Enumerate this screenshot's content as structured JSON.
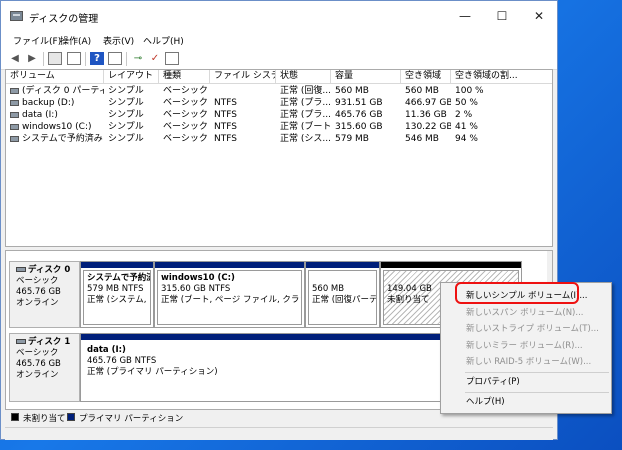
{
  "window": {
    "title": "ディスクの管理",
    "min": "—",
    "max": "☐",
    "close": "✕"
  },
  "menu": [
    "ファイル(F)",
    "操作(A)",
    "表示(V)",
    "ヘルプ(H)"
  ],
  "volumes": {
    "columns": [
      "ボリューム",
      "レイアウト",
      "種類",
      "ファイル システム",
      "状態",
      "容量",
      "空き領域",
      "空き領域の割..."
    ],
    "rows": [
      [
        "(ディスク 0 パーティ...",
        "シンプル",
        "ベーシック",
        "",
        "正常 (回復...",
        "560 MB",
        "560 MB",
        "100 %"
      ],
      [
        "backup (D:)",
        "シンプル",
        "ベーシック",
        "NTFS",
        "正常 (プラ...",
        "931.51 GB",
        "466.97 GB",
        "50 %"
      ],
      [
        "data (I:)",
        "シンプル",
        "ベーシック",
        "NTFS",
        "正常 (プラ...",
        "465.76 GB",
        "11.36 GB",
        "2 %"
      ],
      [
        "windows10 (C:)",
        "シンプル",
        "ベーシック",
        "NTFS",
        "正常 (ブート...",
        "315.60 GB",
        "130.22 GB",
        "41 %"
      ],
      [
        "システムで予約済み",
        "シンプル",
        "ベーシック",
        "NTFS",
        "正常 (シス...",
        "579 MB",
        "546 MB",
        "94 %"
      ]
    ]
  },
  "disks": [
    {
      "name": "ディスク 0",
      "type": "ベーシック",
      "size": "465.76 GB",
      "status": "オンライン",
      "partitions": [
        {
          "name": "システムで予約済",
          "size": "579 MB NTFS",
          "status": "正常 (システム, ア"
        },
        {
          "name": "windows10  (C:)",
          "size": "315.60 GB NTFS",
          "status": "正常 (ブート, ページ ファイル, クラッシュ ダ"
        },
        {
          "name": "",
          "size": "560 MB",
          "status": "正常 (回復パーテ"
        },
        {
          "name": "",
          "size": "149.04 GB",
          "status": "未割り当て"
        }
      ]
    },
    {
      "name": "ディスク 1",
      "type": "ベーシック",
      "size": "465.76 GB",
      "status": "オンライン",
      "partitions": [
        {
          "name": "data  (I:)",
          "size": "465.76 GB NTFS",
          "status": "正常 (プライマリ パーティション)"
        }
      ]
    }
  ],
  "legend": {
    "unallocated": "未割り当て",
    "primary": "プライマリ パーティション"
  },
  "context_menu": {
    "items": [
      {
        "label": "新しいシンプル ボリューム(I)...",
        "enabled": true
      },
      {
        "label": "新しいスパン ボリューム(N)...",
        "enabled": false
      },
      {
        "label": "新しいストライプ ボリューム(T)...",
        "enabled": false
      },
      {
        "label": "新しいミラー ボリューム(R)...",
        "enabled": false
      },
      {
        "label": "新しい RAID-5 ボリューム(W)...",
        "enabled": false
      },
      {
        "label": "プロパティ(P)",
        "enabled": true
      },
      {
        "label": "ヘルプ(H)",
        "enabled": true
      }
    ]
  },
  "colors": {
    "primary_partition": "#001f7a",
    "unallocated": "#000000",
    "highlight": "#ee1111"
  }
}
